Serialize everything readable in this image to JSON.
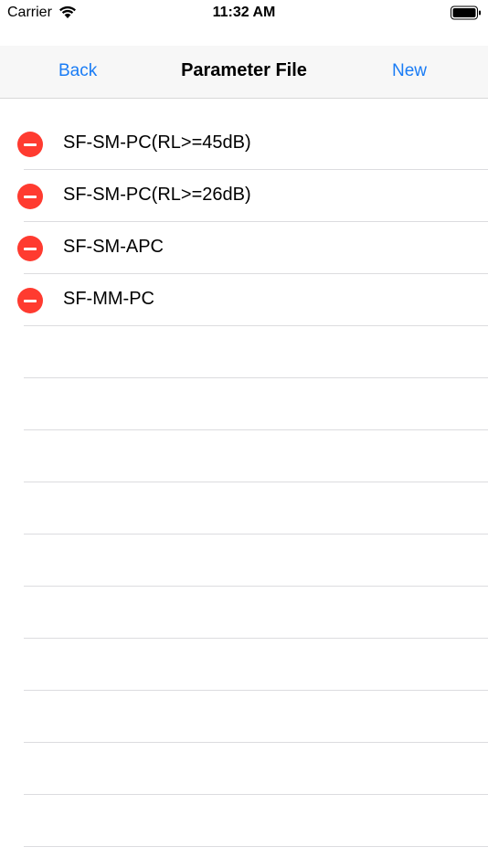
{
  "status_bar": {
    "carrier": "Carrier",
    "time": "11:32 AM",
    "wifi_icon": "wifi-icon",
    "battery_icon": "battery-full-icon"
  },
  "nav": {
    "back_label": "Back",
    "title": "Parameter File",
    "new_label": "New",
    "accent_color": "#1a7cf5"
  },
  "files": [
    {
      "name": "SF-SM-PC(RL>=45dB)"
    },
    {
      "name": "SF-SM-PC(RL>=26dB)"
    },
    {
      "name": "SF-SM-APC"
    },
    {
      "name": "SF-MM-PC"
    }
  ],
  "delete_icon": "minus-circle-icon",
  "delete_color": "#ff3b30"
}
